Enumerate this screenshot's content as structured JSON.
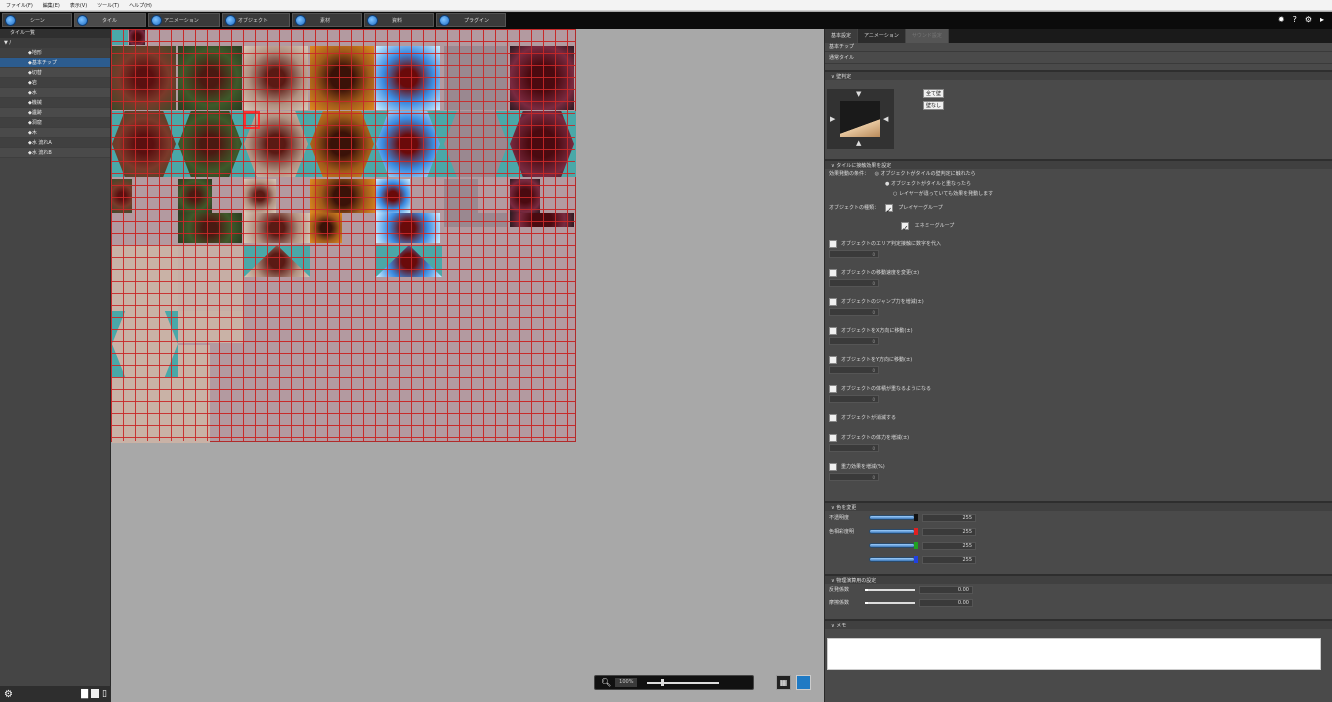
{
  "menubar": {
    "items": [
      "ファイル(F)",
      "編集(E)",
      "表示(V)",
      "ツール(T)",
      "ヘルプ(H)"
    ]
  },
  "toolbar": {
    "tabs": [
      {
        "label": "シーン"
      },
      {
        "label": "タイル"
      },
      {
        "label": "アニメーション"
      },
      {
        "label": "オブジェクト"
      },
      {
        "label": "素材"
      },
      {
        "label": "資料"
      },
      {
        "label": "プラグイン"
      }
    ],
    "right_icons": [
      "✹",
      "?",
      "⚙",
      "▸"
    ]
  },
  "left_panel": {
    "title": "タイル一覧",
    "root": "▼ /",
    "items": [
      "◆地形",
      "◆基本チップ",
      "◆切替",
      "◆岩",
      "◆水",
      "◆機械",
      "◆遺跡",
      "◆洞窟",
      "◆木",
      "◆水 流れA",
      "◆水 流れB"
    ],
    "selected_index": 1
  },
  "canvas": {
    "zoom_value": "100%",
    "zoom_icon": "magnifier-icon",
    "grid_toggle_icon": "grid-icon"
  },
  "right_panel": {
    "tabs": [
      {
        "label": "基本設定",
        "state": "active"
      },
      {
        "label": "アニメーション",
        "state": "normal"
      },
      {
        "label": "サウンド設定",
        "state": "disabled"
      }
    ],
    "chip_type": "基本チップ",
    "tile_type": "通常タイル",
    "section_collision": "∨ 壁判定",
    "btn_all_wall": "全て壁",
    "btn_no_wall": "壁なし",
    "section_effect": "∨ タイルに接触効果を設定",
    "effect_condition_label": "効果発動の条件：",
    "effect_conditions": [
      "◎ オブジェクトがタイルの壁判定に触れたら",
      "● オブジェクトがタイルと重なったら",
      "○ レイヤーが違っていても効果を発動します"
    ],
    "object_type_label": "オブジェクトの種類：",
    "object_types": [
      "プレイヤーグループ",
      "エネミーグループ"
    ],
    "effects": [
      {
        "label": "オブジェクトのエリア判定接触に数字を代入",
        "value": "0",
        "has_input": true
      },
      {
        "label": "オブジェクトの移動速度を変更(±)",
        "value": "0",
        "has_input": true
      },
      {
        "label": "オブジェクトのジャンプ力を増減(±)",
        "value": "0",
        "has_input": true
      },
      {
        "label": "オブジェクトをX方向に移動(±)",
        "value": "0",
        "has_input": true
      },
      {
        "label": "オブジェクトをY方向に移動(±)",
        "value": "0",
        "has_input": true
      },
      {
        "label": "オブジェクトの体積が重なるようになる",
        "value": "0",
        "has_input": true
      },
      {
        "label": "オブジェクトが消滅する",
        "value": "",
        "has_input": false
      },
      {
        "label": "オブジェクトの体力を増減(±)",
        "value": "0",
        "has_input": true
      },
      {
        "label": "重力効果を増減(%)",
        "value": "0",
        "has_input": true
      }
    ],
    "section_color": "∨ 色を変更",
    "opacity_label": "不透明度",
    "color_label": "色相彩度明",
    "color_rows": [
      {
        "value": "255",
        "mark": "#111111",
        "level": 1.0
      },
      {
        "value": "255",
        "mark": "#e02020",
        "level": 1.0
      },
      {
        "value": "255",
        "mark": "#20a020",
        "level": 1.0
      },
      {
        "value": "255",
        "mark": "#2040e0",
        "level": 1.0
      }
    ],
    "section_physics": "∨ 物理演算用の設定",
    "physics_rows": [
      {
        "label": "反発係数",
        "value": "0.00"
      },
      {
        "label": "摩擦係数",
        "value": "0.00"
      }
    ],
    "section_memo": "∨ メモ",
    "memo_text": ""
  }
}
